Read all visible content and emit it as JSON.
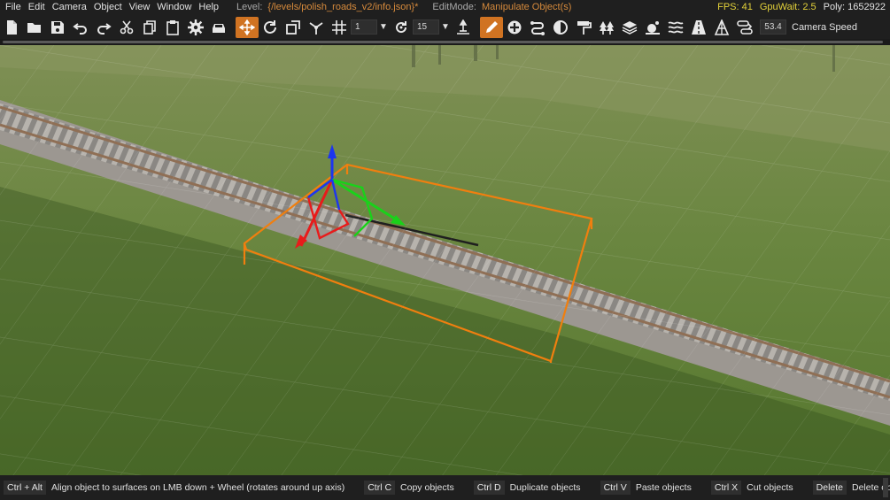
{
  "menu": {
    "items": [
      "File",
      "Edit",
      "Camera",
      "Object",
      "View",
      "Window",
      "Help"
    ],
    "level_label": "Level:",
    "level_value": "{/levels/polish_roads_v2/info.json}*",
    "editmode_label": "EditMode:",
    "editmode_value": "Manipulate Object(s)",
    "fps": "FPS: 41",
    "gpuwait": "GpuWait: 2.5",
    "poly": "Poly: 1652922"
  },
  "toolbar": {
    "snap_angle": "1",
    "rotate_step": "15",
    "camera_speed_value": "53.4",
    "camera_speed_label": "Camera Speed",
    "icons": [
      "new-file-icon",
      "open-folder-icon",
      "save-icon",
      "undo-icon",
      "redo-icon",
      "cut-icon",
      "copy-icon",
      "paste-icon",
      "settings-gear-icon",
      "vehicle-icon",
      "translate-tool-icon",
      "rotate-tool-icon",
      "scale-tool-icon",
      "snap-vertex-icon",
      "grid-snap-icon",
      "rotate-snap-icon",
      "terrain-align-icon",
      "edit-pencil-icon",
      "add-object-icon",
      "road-tool-icon",
      "decal-tool-icon",
      "paint-roller-icon",
      "forest-icon",
      "layers-icon",
      "scene-objects-icon",
      "river-tool-icon",
      "road-edit-icon",
      "navmesh-icon",
      "path-tool-icon"
    ]
  },
  "colors": {
    "accent": "#d07322",
    "selection_box": "#f07f0f",
    "gizmo_x": "#e81b1b",
    "gizmo_y": "#1ad11a",
    "gizmo_z": "#1c35f0",
    "fps_warn": "#e4d23a",
    "level_text": "#d68a3c"
  },
  "status": {
    "hints": [
      {
        "key": "Ctrl + Alt",
        "text": "Align object to surfaces on LMB down + Wheel (rotates around up axis)"
      },
      {
        "key": "Ctrl C",
        "text": "Copy objects"
      },
      {
        "key": "Ctrl D",
        "text": "Duplicate objects"
      },
      {
        "key": "Ctrl V",
        "text": "Paste objects"
      },
      {
        "key": "Ctrl X",
        "text": "Cut objects"
      },
      {
        "key": "Delete",
        "text": "Delete objects"
      }
    ]
  }
}
